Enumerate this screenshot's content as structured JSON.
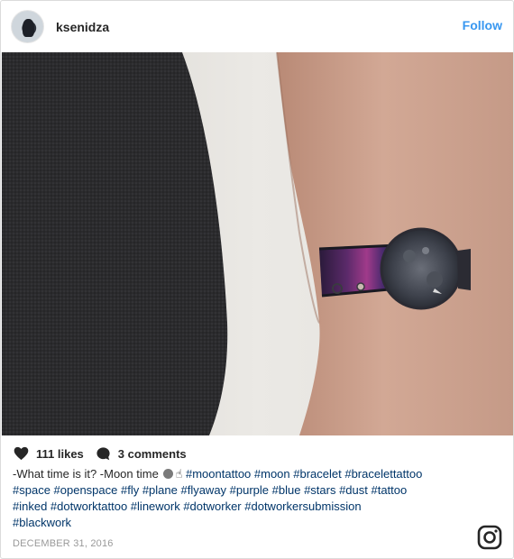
{
  "header": {
    "username": "ksenidza",
    "follow_label": "Follow"
  },
  "photo": {
    "subject": "wrist tattoo photo"
  },
  "actions": {
    "likes": "111 likes",
    "comments": "3 comments",
    "heart_icon": "heart-icon",
    "comment_icon": "comment-bubble-icon"
  },
  "caption": {
    "prefix": "-What time is it? -Moon time",
    "emoji_after": "☝",
    "line1_tags": "#moontattoo #moon #bracelet #bracelettattoo",
    "line2": "#space #openspace #fly #plane #flyaway #purple #blue #stars #dust #tattoo",
    "line3": "#inked #dotworktattoo #linework #dotworker #dotworkersubmission",
    "line4": "#blackwork"
  },
  "date": "DECEMBER 31, 2016",
  "colors": {
    "link": "#3897f0",
    "hashtag": "#003569",
    "text": "#262626",
    "muted": "#999999",
    "border": "#dbdbdb"
  }
}
